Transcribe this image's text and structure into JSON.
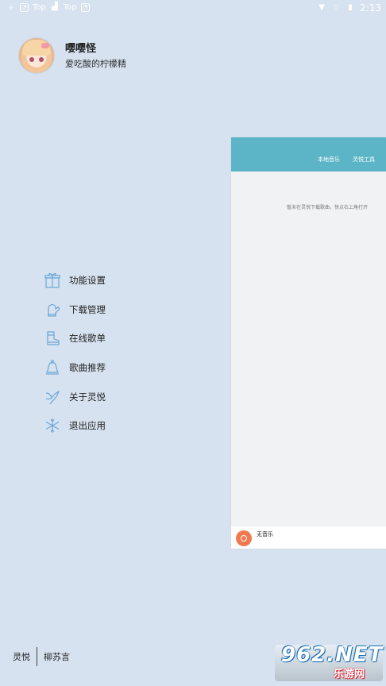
{
  "status_bar": {
    "left_tags": [
      "Top",
      "Top"
    ],
    "time": "2:13",
    "icons": [
      "download-icon",
      "app-badge-icon",
      "bag-icon",
      "wifi-icon",
      "sim-icon",
      "battery-icon"
    ]
  },
  "profile": {
    "name": "嘤嘤怪",
    "signature": "爱吃酸的柠檬精"
  },
  "menu": {
    "items": [
      {
        "label": "功能设置",
        "icon": "gift-icon"
      },
      {
        "label": "下载管理",
        "icon": "mitten-icon"
      },
      {
        "label": "在线歌单",
        "icon": "boot-icon"
      },
      {
        "label": "歌曲推荐",
        "icon": "bell-icon"
      },
      {
        "label": "关于灵悦",
        "icon": "bird-icon"
      },
      {
        "label": "退出应用",
        "icon": "snowflake-icon"
      }
    ]
  },
  "footer": {
    "left": "灵悦",
    "right": "柳苏言"
  },
  "preview": {
    "tabs": [
      "本地音乐",
      "灵悦工具"
    ],
    "empty_message": "暂未在灵悦下载歌曲，快点右上角打开",
    "now_playing": "无音乐"
  },
  "watermark": {
    "big": "962.NET",
    "small": "乐游网"
  },
  "colors": {
    "background": "#d6e2ef",
    "preview_header": "#5bb5c6",
    "icon_stroke": "#6aa7d8",
    "disc": "#f07a4f"
  }
}
